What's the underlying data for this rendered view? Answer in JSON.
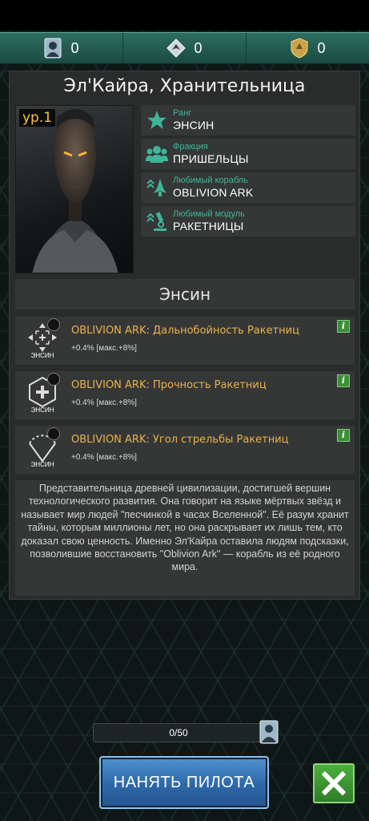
{
  "currencies": [
    {
      "icon": "pilot-card-icon",
      "value": "0"
    },
    {
      "icon": "ship-blueprint-icon",
      "value": "0"
    },
    {
      "icon": "gold-shield-icon",
      "value": "0"
    }
  ],
  "pilot": {
    "name": "Эл'Кайра, Хранительница",
    "level": "ур.1",
    "info": [
      {
        "icon": "star-icon",
        "label": "Ранг",
        "value": "ЭНСИН"
      },
      {
        "icon": "group-icon",
        "label": "Фракция",
        "value": "ПРИШЕЛЬЦЫ"
      },
      {
        "icon": "ship-icon",
        "label": "Любимый корабль",
        "value": "OBLIVION ARK"
      },
      {
        "icon": "microscope-icon",
        "label": "Любимый модуль",
        "value": "РАКЕТНИЦЫ"
      }
    ]
  },
  "rank_header": "Энсин",
  "skills": [
    {
      "icon": "range-icon",
      "rank": "ЭНСИН",
      "title": "OBLIVION ARK: Дальнобойность Ракетниц",
      "desc": "+0.4% [макс.+8%]"
    },
    {
      "icon": "hull-plus-icon",
      "rank": "ЭНСИН",
      "title": "OBLIVION ARK: Прочность Ракетниц",
      "desc": "+0.4% [макс.+8%]"
    },
    {
      "icon": "firing-arc-icon",
      "rank": "ЭНСИН",
      "title": "OBLIVION ARK: Угол стрельбы Ракетниц",
      "desc": "+0.4% [макс.+8%]"
    }
  ],
  "info_button": "i",
  "lore": "Представительница древней цивилизации, достигшей вершин технологического развития. Она говорит на языке мёртвых звёзд и называет мир людей \"песчинкой в часах Вселенной\". Её разум хранит тайны, которым миллионы лет, но она раскрывает их лишь тем, кто доказал свою ценность. Именно Эл'Кайра оставила людям подсказки, позволившие восстановить \"Oblivion Ark\" — корабль из её родного мира.",
  "progress": {
    "text": "0/50",
    "fraction": 0.0
  },
  "hire_button": "НАНЯТЬ ПИЛОТА",
  "colors": {
    "accent": "#3fb59a",
    "skill_title": "#e9b24a",
    "level": "#f4c542",
    "hire": "#2d67a8",
    "close": "#3c8f3a"
  }
}
